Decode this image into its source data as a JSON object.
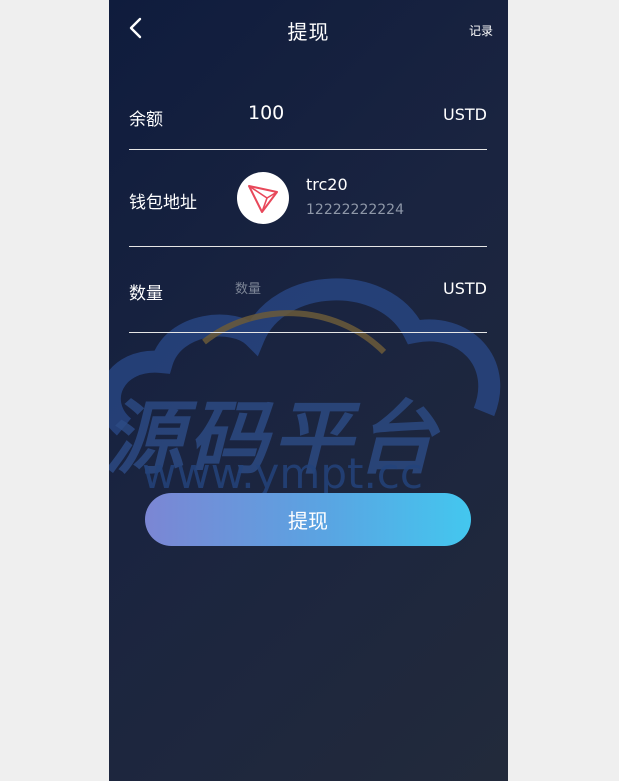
{
  "header": {
    "title": "提现",
    "records_label": "记录",
    "back_icon": "chevron-left-icon"
  },
  "balance": {
    "label": "余额",
    "value": "100",
    "unit": "USTD"
  },
  "wallet": {
    "label": "钱包地址",
    "icon": "tron-icon",
    "network": "trc20",
    "address": "12222222224"
  },
  "amount": {
    "label": "数量",
    "placeholder": "数量",
    "value": "",
    "unit": "USTD"
  },
  "submit": {
    "label": "提现"
  },
  "watermark": {
    "text": "源码平台",
    "url": "www.ympt.cc"
  },
  "colors": {
    "accent_start": "#7b86d4",
    "accent_end": "#43c7ef",
    "tron_red": "#e8485a"
  }
}
